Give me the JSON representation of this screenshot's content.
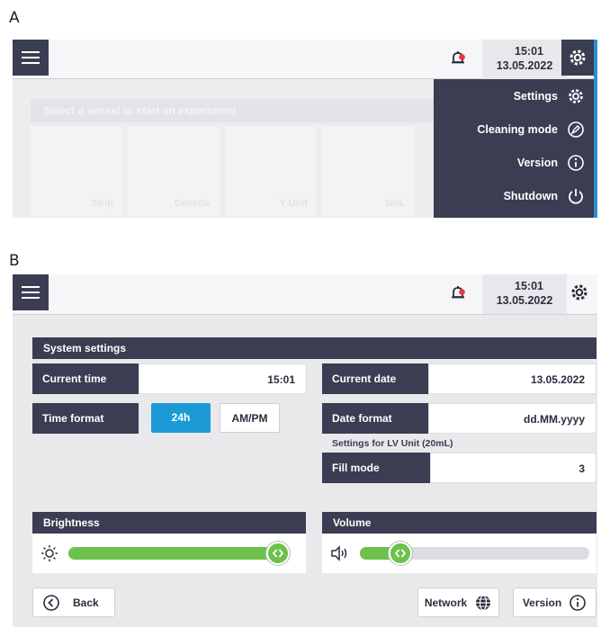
{
  "panels": {
    "a": "A",
    "b": "B"
  },
  "header": {
    "time": "15:01",
    "date": "13.05.2022"
  },
  "panel_a": {
    "background_banner": "Select a vessel to start an experiment",
    "background_tiles": [
      "Strip",
      "Cuvette",
      "Y Unit",
      "1mL"
    ],
    "menu": {
      "settings": "Settings",
      "cleaning_mode": "Cleaning mode",
      "version": "Version",
      "shutdown": "Shutdown"
    }
  },
  "system_settings": {
    "title": "System settings",
    "current_time_label": "Current time",
    "current_time_value": "15:01",
    "current_date_label": "Current date",
    "current_date_value": "13.05.2022",
    "time_format_label": "Time format",
    "time_format_options": [
      "24h",
      "AM/PM"
    ],
    "time_format_selected": "24h",
    "date_format_label": "Date format",
    "date_format_value": "dd.MM.yyyy",
    "lv_unit_note": "Settings for LV Unit (20mL)",
    "fill_mode_label": "Fill mode",
    "fill_mode_value": "3"
  },
  "brightness": {
    "title": "Brightness",
    "level": 1.0
  },
  "volume": {
    "title": "Volume",
    "level": 0.14
  },
  "footer": {
    "back": "Back",
    "network": "Network",
    "version": "Version"
  },
  "colors": {
    "dark": "#3b3d52",
    "accent": "#1b9ad6",
    "slider": "#6cc24a",
    "alert": "#e8354a"
  },
  "icons": [
    "menu-icon",
    "bell-alert-icon",
    "settings-gear-icon",
    "gear-icon",
    "cleaning-icon",
    "info-icon",
    "power-icon",
    "sun-icon",
    "speaker-icon",
    "back-arrow-icon",
    "globe-icon"
  ]
}
